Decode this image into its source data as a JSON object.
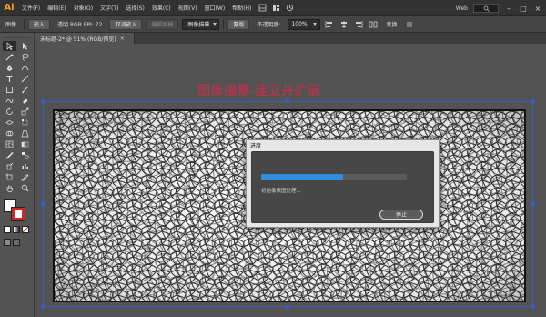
{
  "app": {
    "logo": "Ai"
  },
  "menu": {
    "items": [
      "文件(F)",
      "编辑(E)",
      "对象(O)",
      "文字(T)",
      "选择(S)",
      "效果(C)",
      "视图(V)",
      "窗口(W)",
      "帮助(H)"
    ],
    "workspace": "Web"
  },
  "controlbar": {
    "selection_label": "图像",
    "embed_label": "嵌入",
    "file_info": "透明 RGB PPI: 72",
    "cancel_embed": "取消嵌入",
    "edit_original": "编辑原稿",
    "trace_preset": "图像描摹",
    "mask": "蒙版",
    "opacity_label": "不透明度:",
    "opacity_value": "100%",
    "transform": "变换"
  },
  "document": {
    "tab_title": "未标题-2* @ 51% (RGB/预览)",
    "close_glyph": "×"
  },
  "canvas": {
    "title": "图像描摹-建立并扩展"
  },
  "dialog": {
    "title": "进度",
    "progress": 0.56,
    "status": "初始像素图处理...",
    "stop_label": "停止"
  },
  "colors": {
    "accent": "#2f8ee0",
    "title_red": "#d42a4b",
    "logo": "#f7a21b",
    "selection_blue": "#3a5dc8"
  },
  "icons": {
    "toolbar": [
      "selection-tool",
      "direct-selection-tool",
      "magic-wand-tool",
      "lasso-tool",
      "pen-tool",
      "curvature-tool",
      "type-tool",
      "line-tool",
      "rectangle-tool",
      "paintbrush-tool",
      "shaper-tool",
      "eraser-tool",
      "rotate-tool",
      "scale-tool",
      "width-tool",
      "free-transform-tool",
      "shape-builder-tool",
      "perspective-tool",
      "mesh-tool",
      "gradient-tool",
      "eyedropper-tool",
      "blend-tool",
      "symbol-sprayer-tool",
      "graph-tool",
      "artboard-tool",
      "slice-tool",
      "hand-tool",
      "zoom-tool"
    ]
  }
}
